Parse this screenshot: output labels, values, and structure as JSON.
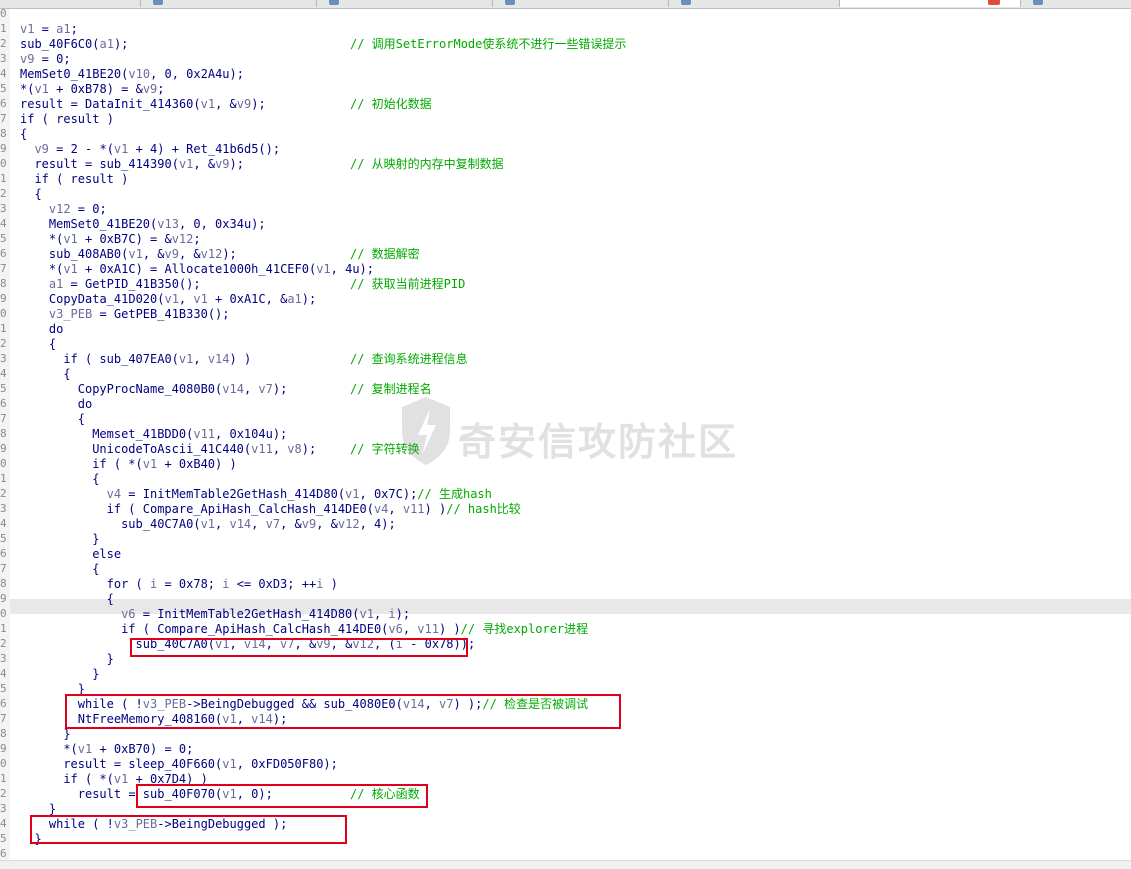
{
  "watermark_text": "奇安信攻防社区",
  "colors": {
    "code_text": "#000080",
    "variable": "#6b6b9b",
    "comment": "#00aa00",
    "annotation_box": "#e0001b"
  },
  "line_numbers": [
    "0",
    "1",
    "2",
    "3",
    "4",
    "5",
    "6",
    "7",
    "8",
    "9",
    "0",
    "1",
    "2",
    "3",
    "4",
    "5",
    "6",
    "7",
    "8",
    "9",
    "0",
    "1",
    "2",
    "3",
    "4",
    "5",
    "6",
    "7",
    "8",
    "9",
    "0",
    "1",
    "2",
    "3",
    "4",
    "5",
    "6",
    "7",
    "8",
    "9",
    "0",
    "1",
    "2",
    "3",
    "4",
    "5",
    "6",
    "7",
    "8",
    "9",
    "0",
    "1",
    "2",
    "3",
    "4",
    "5",
    "6"
  ],
  "code_lines": [
    {
      "indent": 0,
      "code": "v1 = a1;",
      "comment": ""
    },
    {
      "indent": 0,
      "code": "sub_40F6C0(a1);",
      "comment": "// 调用SetErrorMode使系统不进行一些错误提示"
    },
    {
      "indent": 0,
      "code": "v9 = 0;",
      "comment": ""
    },
    {
      "indent": 0,
      "code": "MemSet0_41BE20(v10, 0, 0x2A4u);",
      "comment": ""
    },
    {
      "indent": 0,
      "code": "*(v1 + 0xB78) = &v9;",
      "comment": ""
    },
    {
      "indent": 0,
      "code": "result = DataInit_414360(v1, &v9);",
      "comment": "// 初始化数据"
    },
    {
      "indent": 0,
      "code": "if ( result )",
      "comment": ""
    },
    {
      "indent": 0,
      "code": "{",
      "comment": ""
    },
    {
      "indent": 1,
      "code": "v9 = 2 - *(v1 + 4) + Ret_41b6d5();",
      "comment": ""
    },
    {
      "indent": 1,
      "code": "result = sub_414390(v1, &v9);",
      "comment": "// 从映射的内存中复制数据"
    },
    {
      "indent": 1,
      "code": "if ( result )",
      "comment": ""
    },
    {
      "indent": 1,
      "code": "{",
      "comment": ""
    },
    {
      "indent": 2,
      "code": "v12 = 0;",
      "comment": ""
    },
    {
      "indent": 2,
      "code": "MemSet0_41BE20(v13, 0, 0x34u);",
      "comment": ""
    },
    {
      "indent": 2,
      "code": "*(v1 + 0xB7C) = &v12;",
      "comment": ""
    },
    {
      "indent": 2,
      "code": "sub_408AB0(v1, &v9, &v12);",
      "comment": "// 数据解密"
    },
    {
      "indent": 2,
      "code": "*(v1 + 0xA1C) = Allocate1000h_41CEF0(v1, 4u);",
      "comment": ""
    },
    {
      "indent": 2,
      "code": "a1 = GetPID_41B350();",
      "comment": "// 获取当前进程PID"
    },
    {
      "indent": 2,
      "code": "CopyData_41D020(v1, v1 + 0xA1C, &a1);",
      "comment": ""
    },
    {
      "indent": 2,
      "code": "v3_PEB = GetPEB_41B330();",
      "comment": ""
    },
    {
      "indent": 2,
      "code": "do",
      "comment": ""
    },
    {
      "indent": 2,
      "code": "{",
      "comment": ""
    },
    {
      "indent": 3,
      "code": "if ( sub_407EA0(v1, v14) )",
      "comment": "// 查询系统进程信息"
    },
    {
      "indent": 3,
      "code": "{",
      "comment": ""
    },
    {
      "indent": 4,
      "code": "CopyProcName_4080B0(v14, v7);",
      "comment": "// 复制进程名"
    },
    {
      "indent": 4,
      "code": "do",
      "comment": ""
    },
    {
      "indent": 4,
      "code": "{",
      "comment": ""
    },
    {
      "indent": 5,
      "code": "Memset_41BDD0(v11, 0x104u);",
      "comment": ""
    },
    {
      "indent": 5,
      "code": "UnicodeToAscii_41C440(v11, v8);",
      "comment": "// 字符转换"
    },
    {
      "indent": 5,
      "code": "if ( *(v1 + 0xB40) )",
      "comment": ""
    },
    {
      "indent": 5,
      "code": "{",
      "comment": ""
    },
    {
      "indent": 6,
      "code": "v4 = InitMemTable2GetHash_414D80(v1, 0x7C);// 生成hash",
      "comment": ""
    },
    {
      "indent": 6,
      "code": "if ( Compare_ApiHash_CalcHash_414DE0(v4, v11) )// hash比较",
      "comment": ""
    },
    {
      "indent": 7,
      "code": "sub_40C7A0(v1, v14, v7, &v9, &v12, 4);",
      "comment": ""
    },
    {
      "indent": 5,
      "code": "}",
      "comment": ""
    },
    {
      "indent": 5,
      "code": "else",
      "comment": ""
    },
    {
      "indent": 5,
      "code": "{",
      "comment": ""
    },
    {
      "indent": 6,
      "code": "for ( i = 0x78; i <= 0xD3; ++i )",
      "comment": ""
    },
    {
      "indent": 6,
      "code": "{",
      "comment": ""
    },
    {
      "indent": 7,
      "code": "v6 = InitMemTable2GetHash_414D80(v1, i);",
      "comment": ""
    },
    {
      "indent": 7,
      "code": "if ( Compare_ApiHash_CalcHash_414DE0(v6, v11) )// 寻找explorer进程",
      "comment": ""
    },
    {
      "indent": 8,
      "code": "sub_40C7A0(v1, v14, v7, &v9, &v12, (i - 0x78));",
      "comment": ""
    },
    {
      "indent": 6,
      "code": "}",
      "comment": ""
    },
    {
      "indent": 5,
      "code": "}",
      "comment": ""
    },
    {
      "indent": 4,
      "code": "}",
      "comment": ""
    },
    {
      "indent": 4,
      "code": "while ( !v3_PEB->BeingDebugged && sub_4080E0(v14, v7) );// 检查是否被调试",
      "comment": ""
    },
    {
      "indent": 4,
      "code": "NtFreeMemory_408160(v1, v14);",
      "comment": ""
    },
    {
      "indent": 3,
      "code": "}",
      "comment": ""
    },
    {
      "indent": 3,
      "code": "*(v1 + 0xB70) = 0;",
      "comment": ""
    },
    {
      "indent": 3,
      "code": "result = sleep_40F660(v1, 0xFD050F80);",
      "comment": ""
    },
    {
      "indent": 3,
      "code": "if ( *(v1 + 0x7D4) )",
      "comment": ""
    },
    {
      "indent": 4,
      "code": "result = sub_40F070(v1, 0);",
      "comment": "// 核心函数"
    },
    {
      "indent": 2,
      "code": "}",
      "comment": ""
    },
    {
      "indent": 2,
      "code": "while ( !v3_PEB->BeingDebugged );",
      "comment": ""
    },
    {
      "indent": 1,
      "code": "}",
      "comment": ""
    }
  ]
}
